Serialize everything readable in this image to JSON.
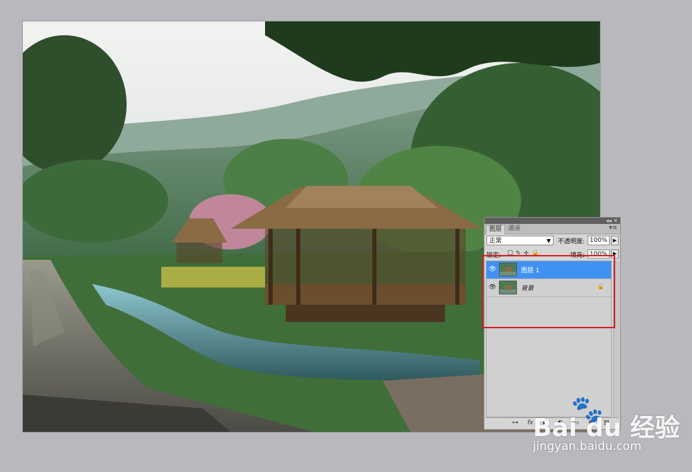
{
  "layers_panel": {
    "tabs": [
      "图层",
      "通道"
    ],
    "blend_mode": "正常",
    "opacity_label": "不透明度:",
    "opacity_value": "100%",
    "lock_label": "锁定:",
    "fill_label": "填充:",
    "fill_value": "100%",
    "layers": [
      {
        "name": "图层 1",
        "selected": true,
        "visible": true,
        "locked": false
      },
      {
        "name": "背景",
        "selected": false,
        "visible": true,
        "locked": true
      }
    ]
  },
  "highlight": {
    "color": "#d21e26"
  },
  "watermark": {
    "brand": "Bai du 经验",
    "url": "jingyan.baidu.com"
  },
  "icons": {
    "eye": "eye-icon",
    "lock": "lock-icon",
    "link": "link-icon",
    "fx": "fx-icon",
    "mask": "mask-icon",
    "adjustment": "adjustment-icon",
    "folder": "folder-icon",
    "new_layer": "new-layer-icon",
    "trash": "trash-icon"
  },
  "colors": {
    "selected_layer": "#3f92f2",
    "background": "#b9b8bd"
  }
}
